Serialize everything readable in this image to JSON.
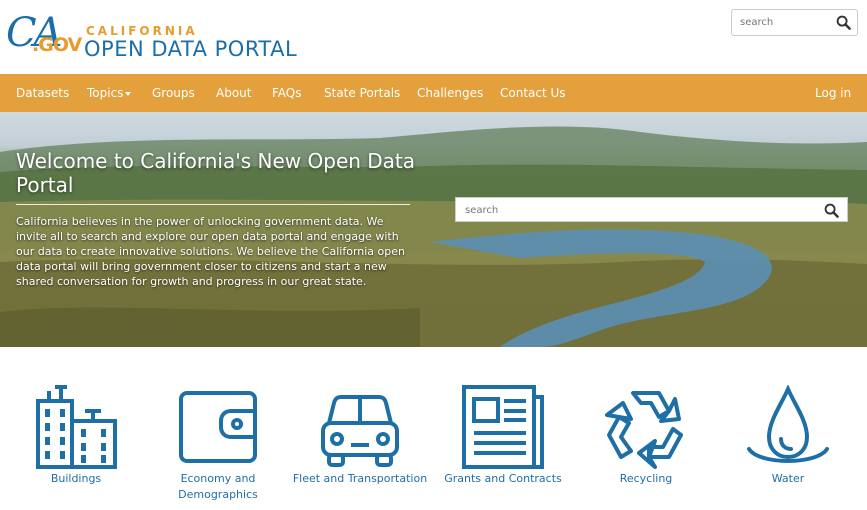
{
  "header": {
    "logo_ca": "CA",
    "logo_gov": ".GOV",
    "logo_state": "CALIFORNIA",
    "logo_title": "OPEN DATA PORTAL",
    "search_placeholder": "search"
  },
  "nav": {
    "items": [
      {
        "label": "Datasets"
      },
      {
        "label": "Topics"
      },
      {
        "label": "Groups"
      },
      {
        "label": "About"
      },
      {
        "label": "FAQs"
      },
      {
        "label": "State Portals"
      },
      {
        "label": "Challenges"
      },
      {
        "label": "Contact Us"
      }
    ],
    "login": "Log in"
  },
  "hero": {
    "title": "Welcome to California's New Open Data Portal",
    "description": "California believes in the power of unlocking government data. We invite all to search and explore our open data portal and engage with our data to create innovative solutions. We believe the California open data portal will bring government closer to citizens and start a new shared conversation for growth and progress in our great state.",
    "search_placeholder": "search"
  },
  "topics": [
    {
      "label": "Buildings",
      "icon": "buildings-icon"
    },
    {
      "label": "Economy and Demographics",
      "icon": "wallet-icon"
    },
    {
      "label": "Fleet and Transportation",
      "icon": "car-icon"
    },
    {
      "label": "Grants and Contracts",
      "icon": "newspaper-icon"
    },
    {
      "label": "Recycling",
      "icon": "recycle-icon"
    },
    {
      "label": "Water",
      "icon": "water-drop-icon"
    }
  ],
  "colors": {
    "brand_blue": "#1e6fa6",
    "nav_orange": "#e3a03c"
  }
}
